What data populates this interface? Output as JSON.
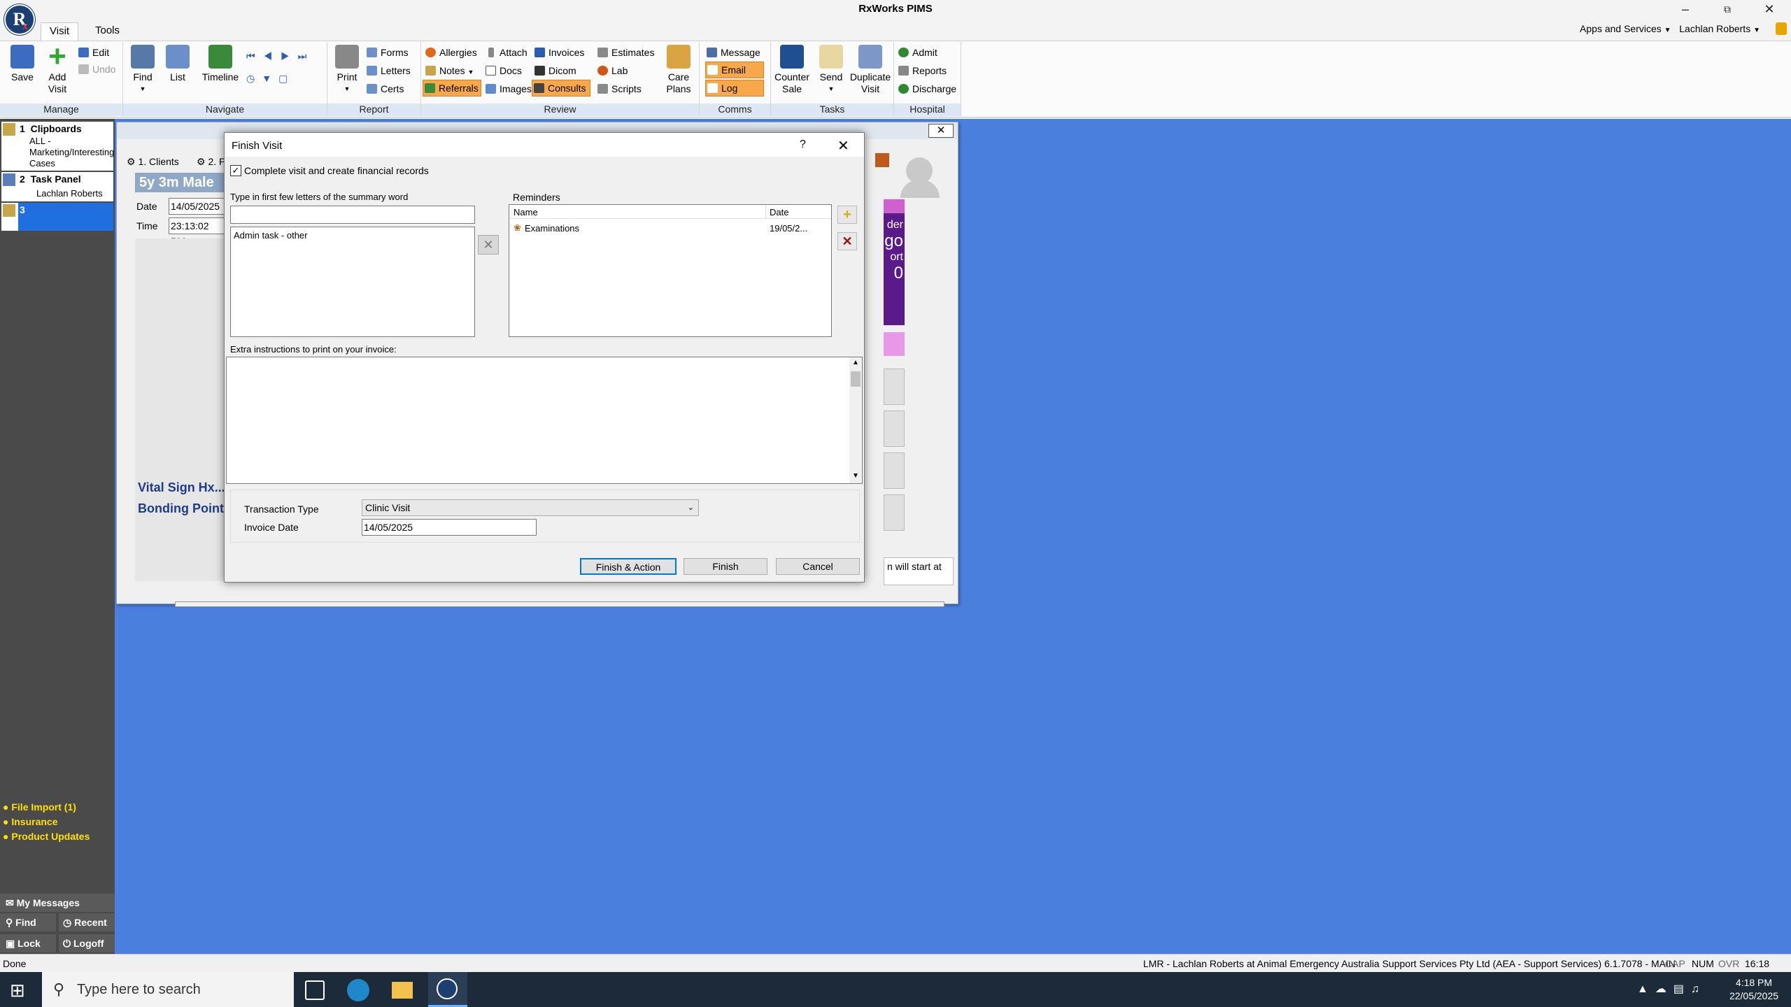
{
  "app": {
    "title": "RxWorks PIMS",
    "logo_text": "R",
    "logo_sub": "x",
    "menu_tabs": [
      "Visit",
      "Tools"
    ],
    "apps_services": "Apps and Services",
    "user": "Lachlan Roberts"
  },
  "ribbon": {
    "manage": {
      "label": "Manage",
      "save": "Save",
      "add_visit": "Add Visit",
      "edit": "Edit",
      "undo": "Undo"
    },
    "navigate": {
      "label": "Navigate",
      "find": "Find",
      "list": "List",
      "timeline": "Timeline"
    },
    "report": {
      "label": "Report",
      "print": "Print",
      "forms": "Forms",
      "letters": "Letters",
      "certs": "Certs"
    },
    "review": {
      "label": "Review",
      "allergies": "Allergies",
      "notes": "Notes",
      "referrals": "Referrals",
      "attach": "Attach",
      "docs": "Docs",
      "images": "Images",
      "invoices": "Invoices",
      "dicom": "Dicom",
      "consults": "Consults",
      "estimates": "Estimates",
      "lab": "Lab",
      "scripts": "Scripts",
      "care_plans": "Care Plans"
    },
    "comms": {
      "label": "Comms",
      "message": "Message",
      "email": "Email",
      "log": "Log"
    },
    "tasks": {
      "label": "Tasks",
      "counter_sale": "Counter Sale",
      "send": "Send",
      "duplicate_visit": "Duplicate Visit"
    },
    "hospital": {
      "label": "Hospital",
      "admit": "Admit",
      "reports": "Reports",
      "discharge": "Discharge"
    }
  },
  "left_panel": {
    "items": [
      {
        "num": "1",
        "title": "Clipboards",
        "sub": "ALL - Marketing/Interesting Cases"
      },
      {
        "num": "2",
        "title": "Task Panel",
        "sub": "Lachlan Roberts"
      },
      {
        "num": "3",
        "title": "",
        "sub": ""
      }
    ],
    "links": [
      "File Import (1)",
      "Insurance",
      "Product Updates"
    ],
    "my_messages": "My Messages",
    "find": "Find",
    "recent": "Recent",
    "lock": "Lock",
    "logoff": "Logoff"
  },
  "background_window": {
    "tab_clients": "1. Clients",
    "tab_2": "2. P",
    "patient_banner": "5y 3m Male Ne",
    "date_label": "Date",
    "date_value": "14/05/2025",
    "time_label": "Time",
    "time_value": "23:13:02 PM",
    "vital_sign": "Vital Sign Hx...",
    "bonding_points": "Bonding Points",
    "right_texts": [
      "der",
      "go",
      "ort",
      "0"
    ],
    "start_text": "n will start at"
  },
  "dialog": {
    "title": "Finish Visit",
    "help": "?",
    "complete_checkbox_label": "Complete visit and create financial records",
    "complete_checked": true,
    "summary_label": "Type in first few letters of the summary word",
    "summary_input_value": "",
    "summary_items": [
      "Admin task - other"
    ],
    "reminders_label": "Reminders",
    "reminders_columns": [
      "Name",
      "Date"
    ],
    "reminders_rows": [
      {
        "name": "Examinations",
        "date": "19/05/2..."
      }
    ],
    "extra_label": "Extra instructions to print on your invoice:",
    "extra_value": "",
    "transaction_type_label": "Transaction Type",
    "transaction_type_value": "Clinic Visit",
    "invoice_date_label": "Invoice Date",
    "invoice_date_value": "14/05/2025",
    "btn_finish_action": "Finish & Action",
    "btn_finish": "Finish",
    "btn_cancel": "Cancel"
  },
  "status": {
    "left": "Done",
    "right": "LMR - Lachlan Roberts at Animal Emergency Australia Support Services Pty Ltd (AEA - Support Services) 6.1.7078 - MAIN",
    "indicators": [
      "CAP",
      "NUM",
      "OVR"
    ],
    "clock": "16:18"
  },
  "taskbar": {
    "search_placeholder": "Type here to search",
    "time": "4:18 PM",
    "date": "22/05/2025"
  },
  "colors": {
    "desktop": "#4a7fde",
    "accent": "#0078d7",
    "highlight_orange": "#f7a84a",
    "left_link_yellow": "#ffe000"
  }
}
